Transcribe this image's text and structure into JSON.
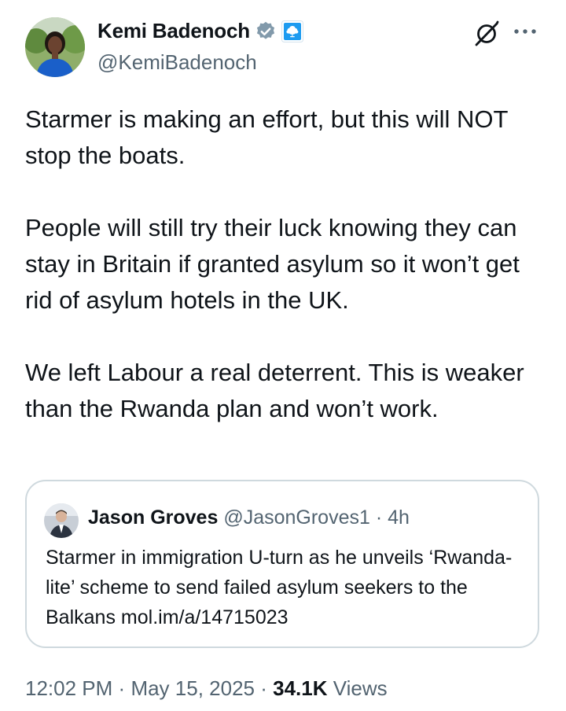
{
  "author": {
    "display_name": "Kemi Badenoch",
    "handle": "@KemiBadenoch",
    "verified_icon": "verified-badge-icon",
    "affiliation_icon": "conservative-tree-icon"
  },
  "tweet": {
    "text": "Starmer is making an effort, but this will NOT stop the boats.\n\nPeople will still try their luck knowing they can stay in Britain if granted asylum so it won’t get rid of asylum hotels in the UK.\n\nWe left Labour a real deterrent. This is weaker than the Rwanda plan and won’t work."
  },
  "quoted": {
    "display_name": "Jason Groves",
    "handle": "@JasonGroves1",
    "separator": "·",
    "time": "4h",
    "text": "Starmer in immigration U-turn as he unveils ‘Rwanda-lite’ scheme to send failed asylum seekers to the Balkans",
    "link": "mol.im/a/14715023"
  },
  "footer": {
    "time": "12:02 PM",
    "sep1": "·",
    "date": "May 15, 2025",
    "sep2": "·",
    "views_count": "34.1K",
    "views_label": "Views"
  },
  "colors": {
    "text": "#0f1419",
    "secondary": "#536471",
    "border": "#cfd9de",
    "verified": "#829aab",
    "affiliation": "#1d9bf0"
  }
}
